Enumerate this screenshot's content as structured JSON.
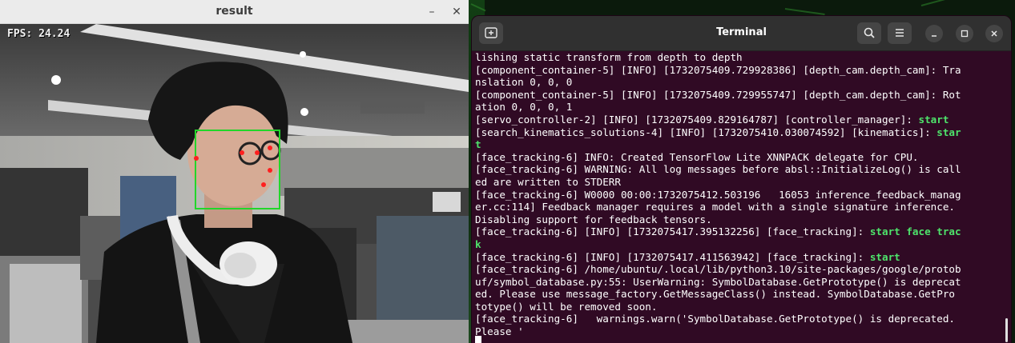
{
  "result_window": {
    "title": "result",
    "minimize_glyph": "–",
    "close_glyph": "✕",
    "fps_label": "FPS: 24.24"
  },
  "terminal": {
    "title": "Terminal",
    "new_tab_icon": "new-tab-icon",
    "search_icon": "search-icon",
    "menu_icon": "hamburger-menu-icon",
    "colors": {
      "background": "#300a24",
      "text": "#ffffff",
      "highlight": "#4ee46b"
    },
    "lines": [
      [
        {
          "t": "lishing static transform from depth to depth"
        }
      ],
      [
        {
          "t": "[component_container-5] [INFO] [1732075409.729928386] [depth_cam.depth_cam]: Tra"
        }
      ],
      [
        {
          "t": "nslation 0, 0, 0"
        }
      ],
      [
        {
          "t": "[component_container-5] [INFO] [1732075409.729955747] [depth_cam.depth_cam]: Rot"
        }
      ],
      [
        {
          "t": "ation 0, 0, 0, 1"
        }
      ],
      [
        {
          "t": "[servo_controller-2] [INFO] [1732075409.829164787] [controller_manager]: "
        },
        {
          "t": "start",
          "hl": true
        }
      ],
      [
        {
          "t": "[search_kinematics_solutions-4] [INFO] [1732075410.030074592] [kinematics]: "
        },
        {
          "t": "star",
          "hl": true
        }
      ],
      [
        {
          "t": "t",
          "hl": true
        }
      ],
      [
        {
          "t": "[face_tracking-6] INFO: Created TensorFlow Lite XNNPACK delegate for CPU."
        }
      ],
      [
        {
          "t": "[face_tracking-6] WARNING: All log messages before absl::InitializeLog() is call"
        }
      ],
      [
        {
          "t": "ed are written to STDERR"
        }
      ],
      [
        {
          "t": "[face_tracking-6] W0000 00:00:1732075412.503196   16053 inference_feedback_manag"
        }
      ],
      [
        {
          "t": "er.cc:114] Feedback manager requires a model with a single signature inference."
        }
      ],
      [
        {
          "t": "Disabling support for feedback tensors."
        }
      ],
      [
        {
          "t": "[face_tracking-6] [INFO] [1732075417.395132256] [face_tracking]: "
        },
        {
          "t": "start face trac",
          "hl": true
        }
      ],
      [
        {
          "t": "k",
          "hl": true
        }
      ],
      [
        {
          "t": "[face_tracking-6] [INFO] [1732075417.411563942] [face_tracking]: "
        },
        {
          "t": "start",
          "hl": true
        }
      ],
      [
        {
          "t": "[face_tracking-6] /home/ubuntu/.local/lib/python3.10/site-packages/google/protob"
        }
      ],
      [
        {
          "t": "uf/symbol_database.py:55: UserWarning: SymbolDatabase.GetPrototype() is deprecat"
        }
      ],
      [
        {
          "t": "ed. Please use message_factory.GetMessageClass() instead. SymbolDatabase.GetPro"
        }
      ],
      [
        {
          "t": "totype() will be removed soon."
        }
      ],
      [
        {
          "t": "[face_tracking-6]   warnings.warn('SymbolDatabase.GetPrototype() is deprecated."
        }
      ],
      [
        {
          "t": "Please '"
        }
      ]
    ]
  }
}
